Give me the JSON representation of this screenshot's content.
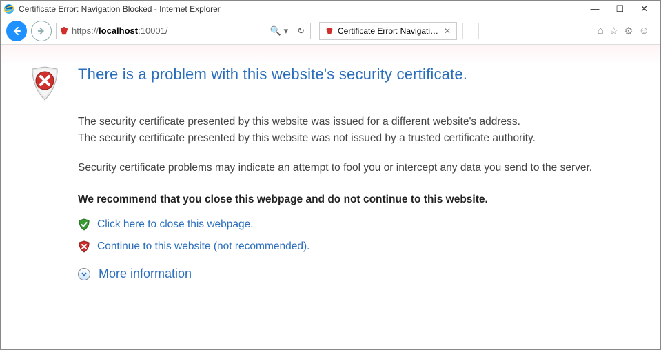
{
  "window": {
    "title": "Certificate Error: Navigation Blocked - Internet Explorer"
  },
  "nav": {
    "url_proto": "https://",
    "url_host": "localhost",
    "url_port": ":10001/"
  },
  "tab": {
    "label": "Certificate Error: Navigation..."
  },
  "cert": {
    "headline": "There is a problem with this website's security certificate.",
    "line1": "The security certificate presented by this website was issued for a different website's address.",
    "line2": "The security certificate presented by this website was not issued by a trusted certificate authority.",
    "line3": "Security certificate problems may indicate an attempt to fool you or intercept any data you send to the server.",
    "recommend": "We recommend that you close this webpage and do not continue to this website.",
    "close_link": "Click here to close this webpage.",
    "continue_link": "Continue to this website (not recommended).",
    "more_info": "More information"
  }
}
